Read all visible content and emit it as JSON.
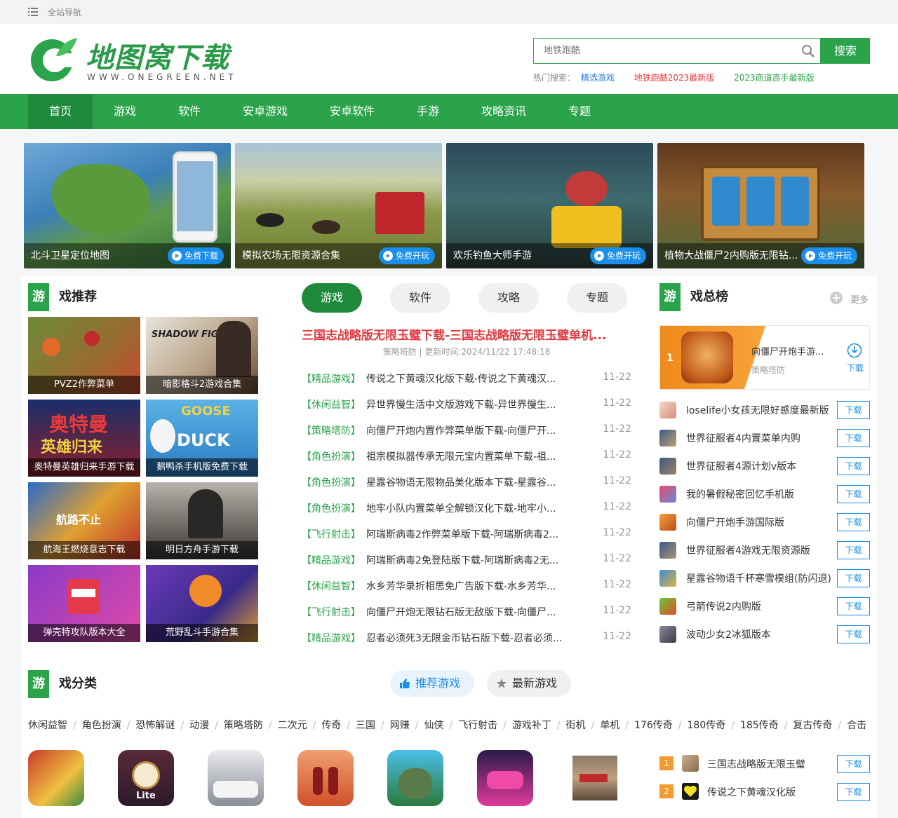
{
  "topbar": {
    "nav_label": "全站导航"
  },
  "header": {
    "logo_text": "地图窝下载",
    "logo_url": "WWW.ONEGREEN.NET",
    "search_placeholder": "地铁跑酷",
    "search_button": "搜索",
    "hot_label": "热门搜索：",
    "hot_links": [
      {
        "label": "精选游戏",
        "color": "#2a7bd0"
      },
      {
        "label": "地铁跑酷2023最新版",
        "color": "#e0393e"
      },
      {
        "label": "2023商道高手最新版",
        "color": "#2aa34a"
      }
    ]
  },
  "nav": [
    "首页",
    "游戏",
    "软件",
    "安卓游戏",
    "安卓软件",
    "手游",
    "攻略资讯",
    "专题"
  ],
  "banners": [
    {
      "caption": "北斗卫星定位地图",
      "button": "免费下载"
    },
    {
      "caption": "模拟农场无限资源合集",
      "button": "免费开玩"
    },
    {
      "caption": "欢乐钓鱼大师手游",
      "button": "免费开玩"
    },
    {
      "caption": "植物大战僵尸2内购版无限钻...",
      "button": "免费开玩"
    }
  ],
  "recommend": {
    "badge": "游",
    "title_rest": "戏推荐",
    "tiles": [
      "PVZ2作弊菜单",
      "暗影格斗2游戏合集",
      "奥特曼英雄归来手游下载",
      "鹅鸭杀手机版免费下载",
      "航海王燃烧意志下载",
      "明日方舟手游下载",
      "弹壳特攻队版本大全",
      "荒野乱斗手游合集"
    ]
  },
  "tabs": [
    "游戏",
    "软件",
    "攻略",
    "专题"
  ],
  "headline": {
    "title": "三国志战略版无限玉璧下载-三国志战略版无限玉璧单机...",
    "meta": "策略塔防 | 更新时间:2024/11/22 17:48:18"
  },
  "news": [
    {
      "cat": "【精品游戏】",
      "title": "传说之下黄魂汉化版下载-传说之下黄魂汉...",
      "date": "11-22"
    },
    {
      "cat": "【休闲益智】",
      "title": "异世界慢生活中文版游戏下载-异世界慢生...",
      "date": "11-22"
    },
    {
      "cat": "【策略塔防】",
      "title": "向僵尸开炮内置作弊菜单版下载-向僵尸开...",
      "date": "11-22"
    },
    {
      "cat": "【角色扮演】",
      "title": "祖宗模拟器传承无限元宝内置菜单下载-祖...",
      "date": "11-22"
    },
    {
      "cat": "【角色扮演】",
      "title": "星露谷物语无限物品美化版本下载-星露谷...",
      "date": "11-22"
    },
    {
      "cat": "【角色扮演】",
      "title": "地牢小队内置菜单全解锁汉化下载-地牢小...",
      "date": "11-22"
    },
    {
      "cat": "【飞行射击】",
      "title": "阿瑞斯病毒2作弊菜单版下载-阿瑞斯病毒2...",
      "date": "11-22"
    },
    {
      "cat": "【精品游戏】",
      "title": "阿瑞斯病毒2免登陆版下载-阿瑞斯病毒2无...",
      "date": "11-22"
    },
    {
      "cat": "【休闲益智】",
      "title": "水乡芳华录折相思免广告版下载-水乡芳华...",
      "date": "11-22"
    },
    {
      "cat": "【飞行射击】",
      "title": "向僵尸开炮无限钻石版无敌版下载-向僵尸...",
      "date": "11-22"
    },
    {
      "cat": "【精品游戏】",
      "title": "忍者必须死3无限金币钻石版下载-忍者必须...",
      "date": "11-22"
    }
  ],
  "ranking": {
    "badge": "游",
    "title_rest": "戏总榜",
    "more": "更多",
    "top": {
      "rank": "1",
      "name": "向僵尸开炮手游...",
      "cat": "策略塔防",
      "download": "下载"
    },
    "rows": [
      "loselife小女孩无限好感度最新版",
      "世界征服者4内置菜单内购",
      "世界征服者4源计划v版本",
      "我的暑假秘密回忆手机版",
      "向僵尸开炮手游国际版",
      "世界征服者4游戏无限资源版",
      "星露谷物语千杯寒雪模组(防闪退)",
      "弓箭传说2内购版",
      "波动少女2冰狐版本"
    ],
    "download_label": "下载"
  },
  "categories": {
    "badge": "游",
    "title_rest": "戏分类",
    "tab_recommend": "推荐游戏",
    "tab_latest": "最新游戏",
    "list": [
      "休闲益智",
      "角色扮演",
      "恐怖解谜",
      "动漫",
      "策略塔防",
      "二次元",
      "传奇",
      "三国",
      "网赚",
      "仙侠",
      "飞行射击",
      "游戏补丁",
      "街机",
      "单机",
      "176传奇",
      "180传奇",
      "185传奇",
      "复古传奇",
      "合击"
    ],
    "icon_labels": [
      "Lite"
    ]
  },
  "rank2": [
    {
      "num": "1",
      "name": "三国志战略版无限玉璧"
    },
    {
      "num": "2",
      "name": "传说之下黄魂汉化版"
    }
  ]
}
